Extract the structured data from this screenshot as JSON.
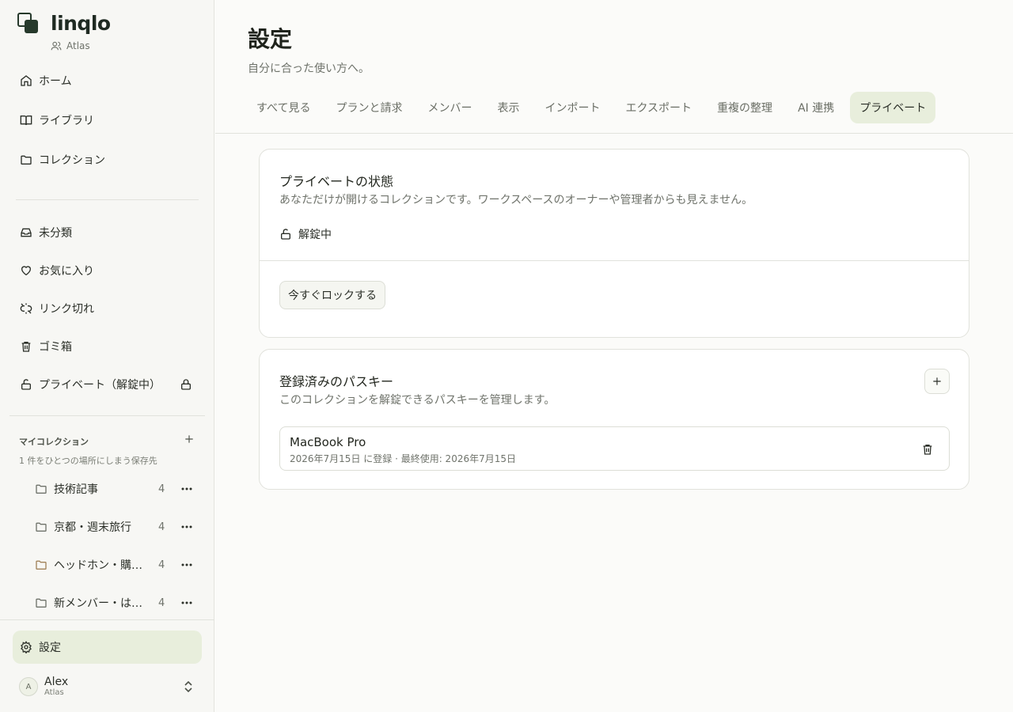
{
  "app": {
    "name": "linqlo",
    "workspace": "Atlas"
  },
  "sidebar": {
    "primary": [
      {
        "label": "ホーム",
        "icon": "home-icon"
      },
      {
        "label": "ライブラリ",
        "icon": "book-icon"
      },
      {
        "label": "コレクション",
        "icon": "folder-icon"
      }
    ],
    "secondary": [
      {
        "label": "未分類",
        "icon": "inbox-icon"
      },
      {
        "label": "お気に入り",
        "icon": "heart-icon"
      },
      {
        "label": "リンク切れ",
        "icon": "broken-link-icon"
      },
      {
        "label": "ゴミ箱",
        "icon": "trash-icon"
      },
      {
        "label": "プライベート（解錠中）",
        "icon": "unlock-icon"
      }
    ],
    "my_collections": {
      "title": "マイコレクション",
      "subtitle": "1 件をひとつの場所にしまう保存先",
      "items": [
        {
          "name": "技術記事",
          "count": "4"
        },
        {
          "name": "京都・週末旅行",
          "count": "4"
        },
        {
          "name": "ヘッドホン・購入検討",
          "count": "4"
        },
        {
          "name": "新メンバー・はじめに",
          "count": "4"
        }
      ]
    },
    "settings_label": "設定",
    "user": {
      "name": "Alex",
      "workspace": "Atlas",
      "initial": "A"
    }
  },
  "main": {
    "title": "設定",
    "subtitle": "自分に合った使い方へ。",
    "tabs": [
      {
        "label": "すべて見る"
      },
      {
        "label": "プランと請求"
      },
      {
        "label": "メンバー"
      },
      {
        "label": "表示"
      },
      {
        "label": "インポート"
      },
      {
        "label": "エクスポート"
      },
      {
        "label": "重複の整理"
      },
      {
        "label": "AI 連携"
      },
      {
        "label": "プライベート",
        "active": true
      }
    ],
    "private_status": {
      "title": "プライベートの状態",
      "description": "あなただけが開けるコレクションです。ワークスペースのオーナーや管理者からも見えません。",
      "status": "解錠中",
      "lock_button": "今すぐロックする"
    },
    "passkeys": {
      "title": "登録済みのパスキー",
      "description": "このコレクションを解錠できるパスキーを管理します。",
      "items": [
        {
          "name": "MacBook Pro",
          "meta": "2026年7月15日 に登録 · 最終使用: 2026年7月15日"
        }
      ]
    }
  },
  "colors": {
    "accent_bg": "#e8eedc",
    "brand": "#26392b"
  }
}
